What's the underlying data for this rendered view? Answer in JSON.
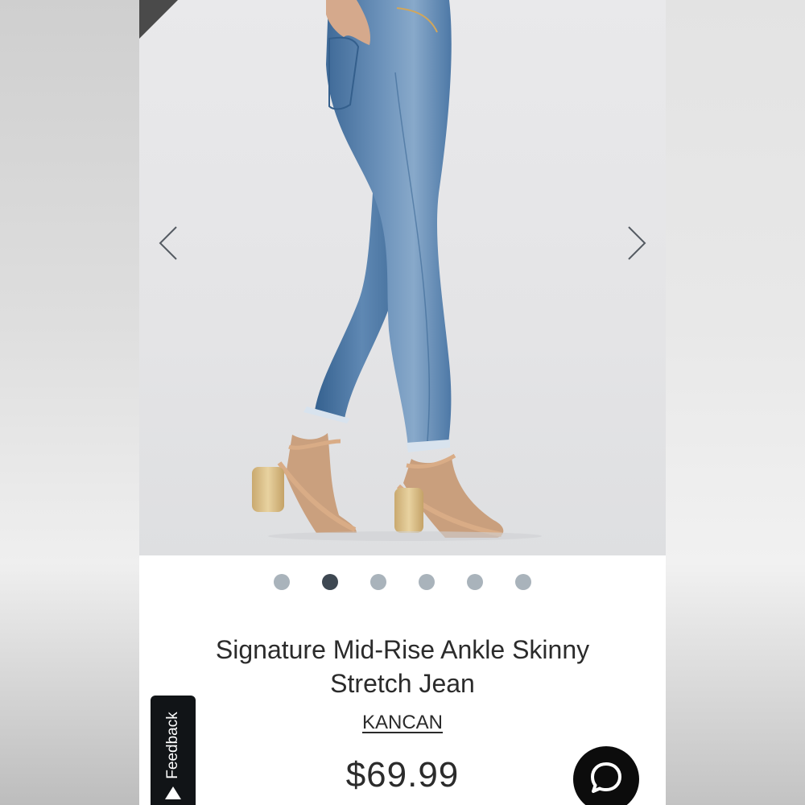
{
  "product": {
    "title": "Signature Mid-Rise Ankle Skinny Stretch Jean",
    "brand": "KANCAN",
    "price": "$69.99"
  },
  "gallery": {
    "image_count": 6,
    "active_index": 1,
    "image_icon": "model-photo-jeans-sandals"
  },
  "feedback": {
    "label": "Feedback"
  },
  "icons": {
    "prev": "chevron-left-icon",
    "next": "chevron-right-icon",
    "chat": "chat-bubble-icon",
    "feedback_arrow": "triangle-up-icon"
  },
  "colors": {
    "dot_active": "#3e4852",
    "dot_inactive": "#a9b3bb",
    "text": "#2b2b2b",
    "chat_button": "#0c0c0c"
  }
}
